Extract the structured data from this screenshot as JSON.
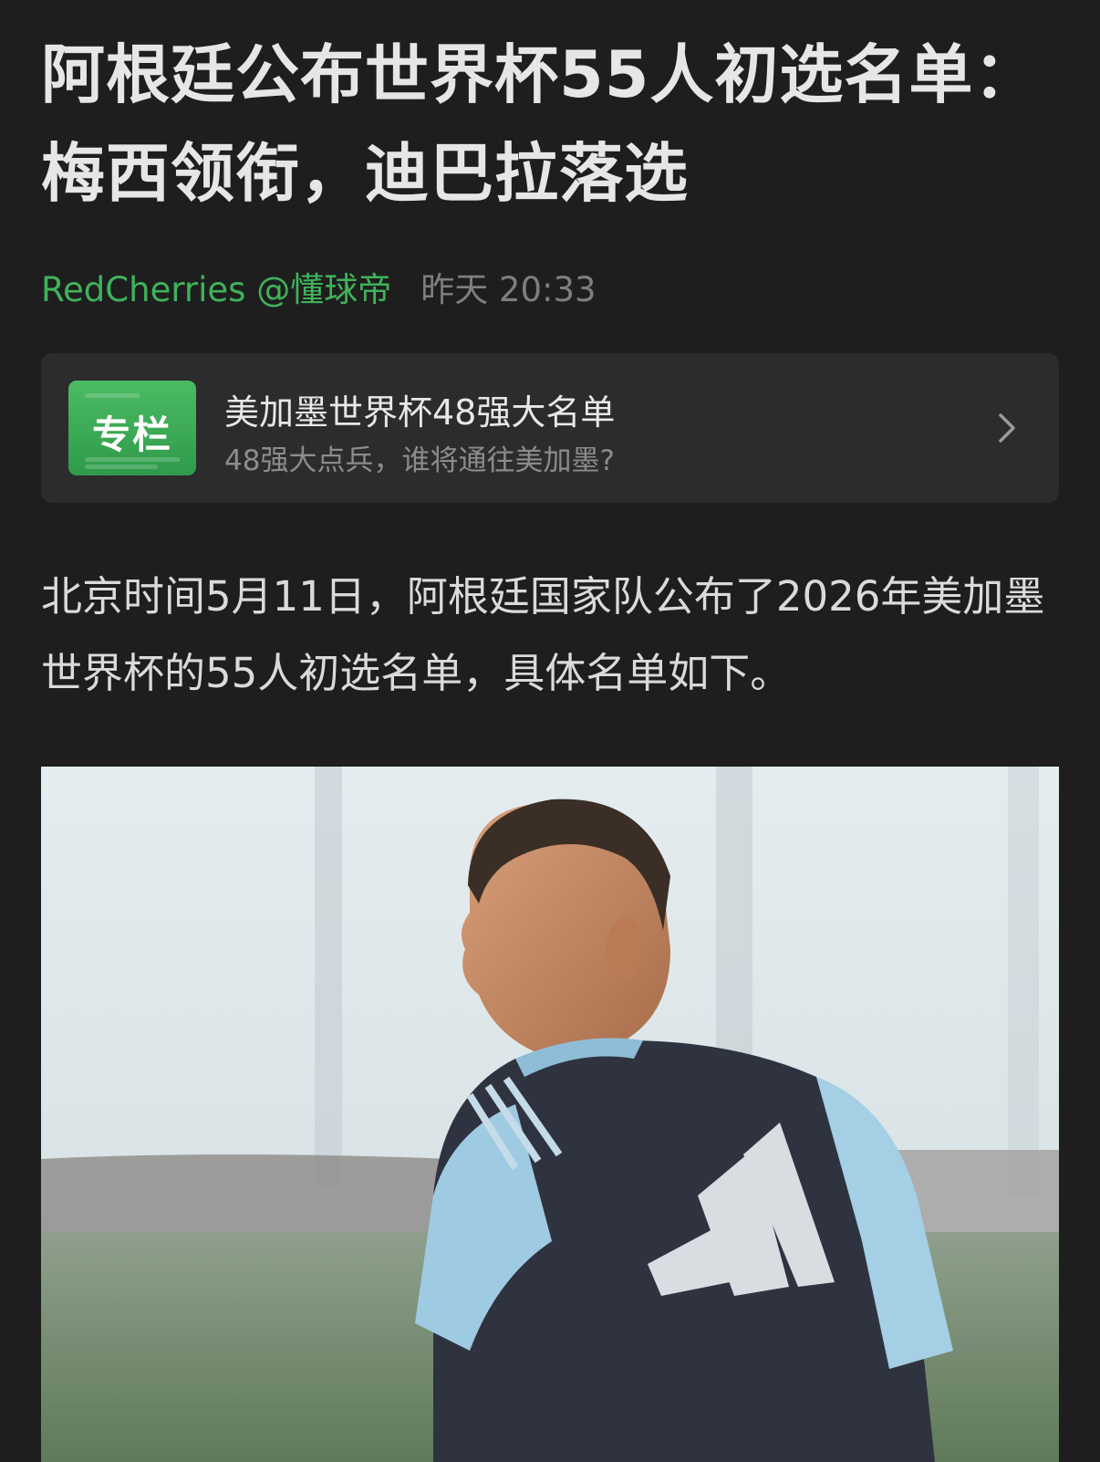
{
  "article": {
    "title": "阿根廷公布世界杯55人初选名单：梅西领衔，迪巴拉落选",
    "author": "RedCherries @懂球帝",
    "time": "昨天 20:33",
    "body": "北京时间5月11日，阿根廷国家队公布了2026年美加墨世界杯的55人初选名单，具体名单如下。"
  },
  "column": {
    "badge": "专栏",
    "title": "美加墨世界杯48强大名单",
    "subtitle": "48强大点兵，谁将通往美加墨?",
    "icon": "chevron-right-icon"
  },
  "colors": {
    "background": "#1e1e1e",
    "accent_green": "#3fb25b",
    "card": "#2c2c2c"
  }
}
